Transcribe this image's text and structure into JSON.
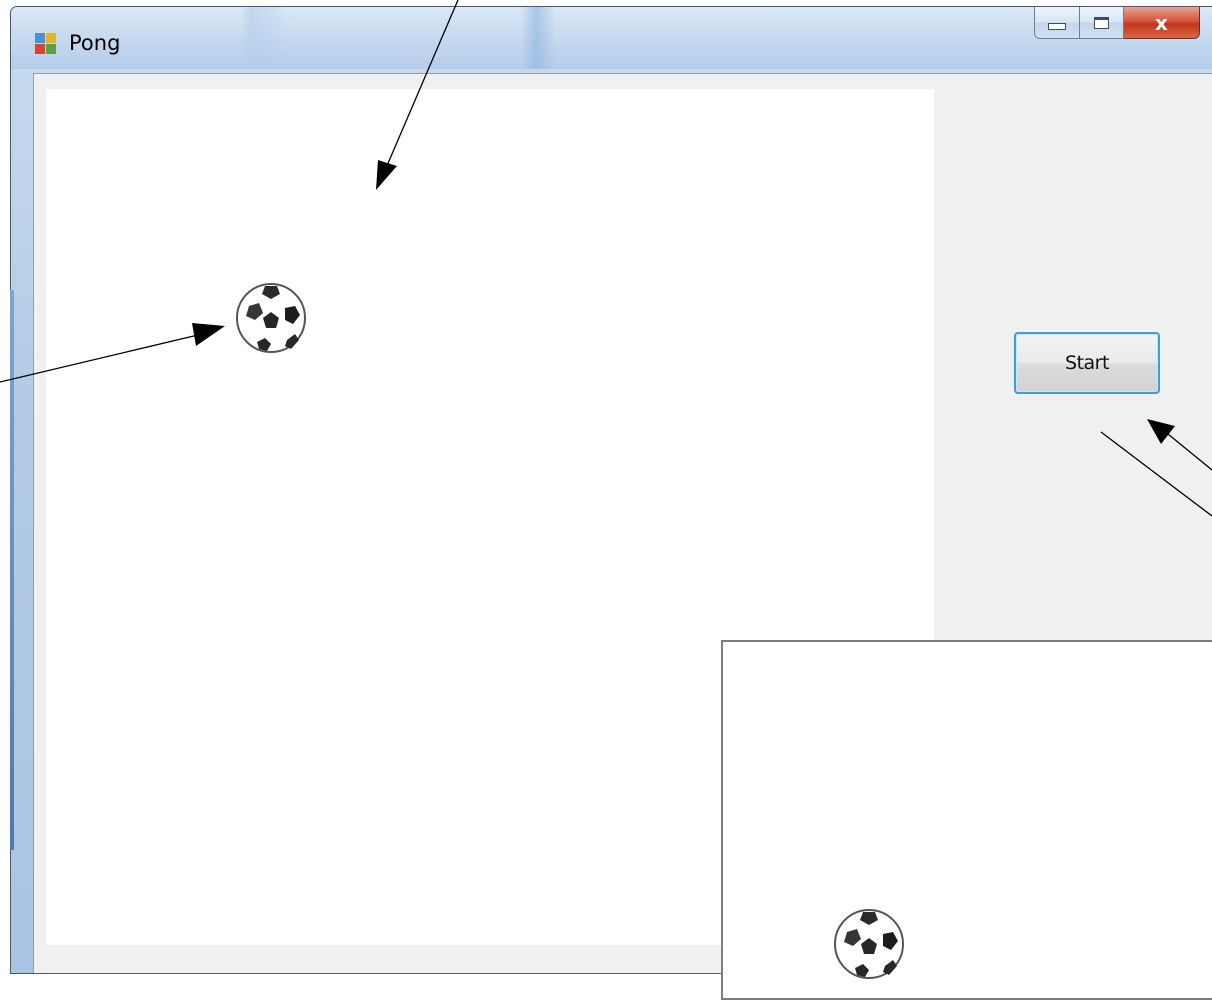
{
  "window": {
    "title": "Pong",
    "close_glyph": "x",
    "icons": [
      "app-icon",
      "minimize-icon",
      "maximize-icon",
      "close-icon"
    ]
  },
  "controls": {
    "start_label": "Start"
  },
  "playfield": {
    "ball_icon": "soccer-ball-icon"
  },
  "inset": {
    "ball_icon": "soccer-ball-icon"
  },
  "colors": {
    "button_focus_border": "#3c9fd6",
    "close_button": "#c3361c",
    "client_background": "#f0f0f0",
    "playfield_background": "#ffffff"
  }
}
